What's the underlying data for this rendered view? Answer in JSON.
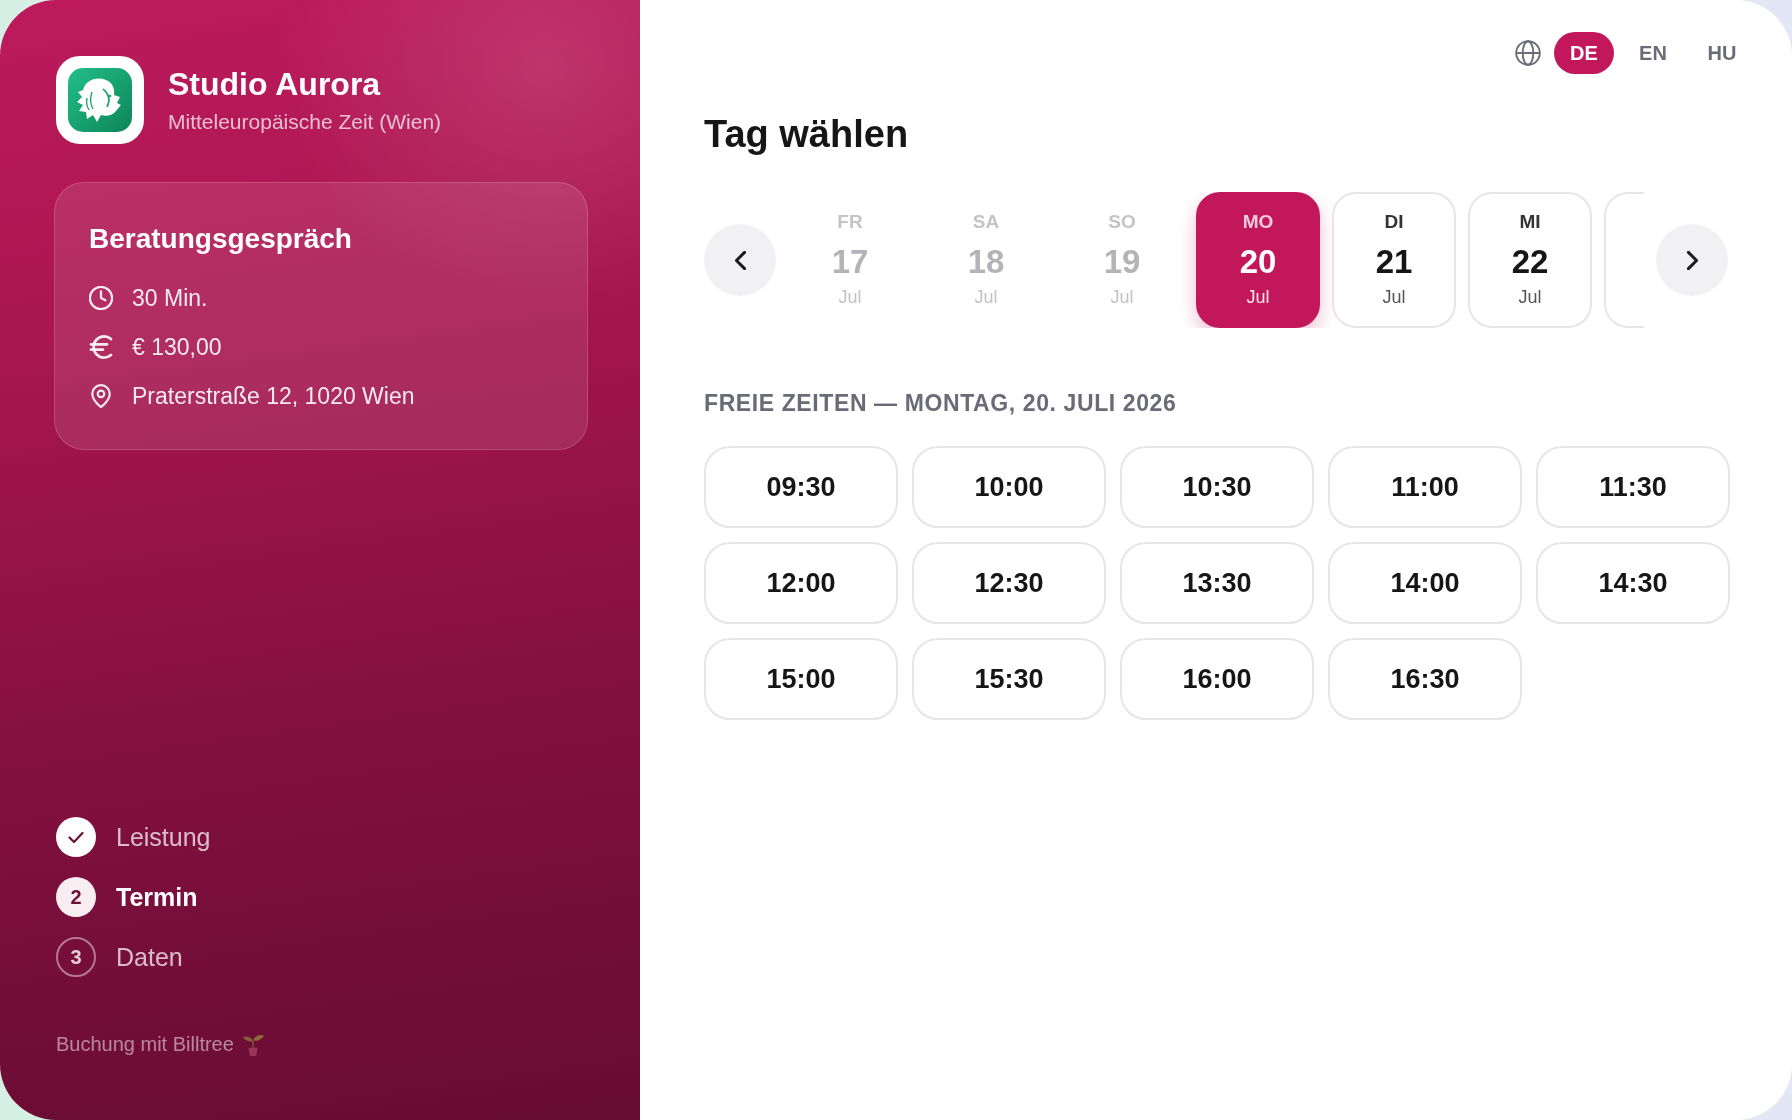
{
  "sidebar": {
    "brand": {
      "name": "Studio Aurora",
      "timezone": "Mitteleuropäische Zeit (Wien)"
    },
    "service": {
      "title": "Beratungsgespräch",
      "details": [
        {
          "kind": "duration",
          "text": "30 Min."
        },
        {
          "kind": "price",
          "text": "€ 130,00"
        },
        {
          "kind": "location",
          "text": "Praterstraße 12, 1020 Wien"
        }
      ]
    },
    "steps": [
      {
        "kind": "done",
        "label": "Leistung"
      },
      {
        "kind": "current",
        "number": "2",
        "label": "Termin"
      },
      {
        "kind": "upcoming",
        "number": "3",
        "label": "Daten"
      }
    ],
    "footer": "Buchung mit Billtree"
  },
  "main": {
    "languages": [
      {
        "code": "DE",
        "selected": true
      },
      {
        "code": "EN",
        "selected": false
      },
      {
        "code": "HU",
        "selected": false
      }
    ],
    "heading": "Tag wählen",
    "days": [
      {
        "kind": "day",
        "weekday": "FR",
        "date": "17",
        "month": "Jul",
        "selected": false,
        "disabled": true
      },
      {
        "kind": "day",
        "weekday": "SA",
        "date": "18",
        "month": "Jul",
        "selected": false,
        "disabled": true
      },
      {
        "kind": "day",
        "weekday": "SO",
        "date": "19",
        "month": "Jul",
        "selected": false,
        "disabled": true
      },
      {
        "kind": "day",
        "weekday": "MO",
        "date": "20",
        "month": "Jul",
        "selected": true,
        "disabled": false
      },
      {
        "kind": "day",
        "weekday": "DI",
        "date": "21",
        "month": "Jul",
        "selected": false,
        "disabled": false
      },
      {
        "kind": "day",
        "weekday": "MI",
        "date": "22",
        "month": "Jul",
        "selected": false,
        "disabled": false
      },
      {
        "kind": "partial",
        "selected": false,
        "disabled": false
      }
    ],
    "slots_heading": "FREIE ZEITEN — MONTAG, 20. JULI 2026",
    "slots": [
      "09:30",
      "10:00",
      "10:30",
      "11:00",
      "11:30",
      "12:00",
      "12:30",
      "13:30",
      "14:00",
      "14:30",
      "15:00",
      "15:30",
      "16:00",
      "16:30"
    ]
  }
}
